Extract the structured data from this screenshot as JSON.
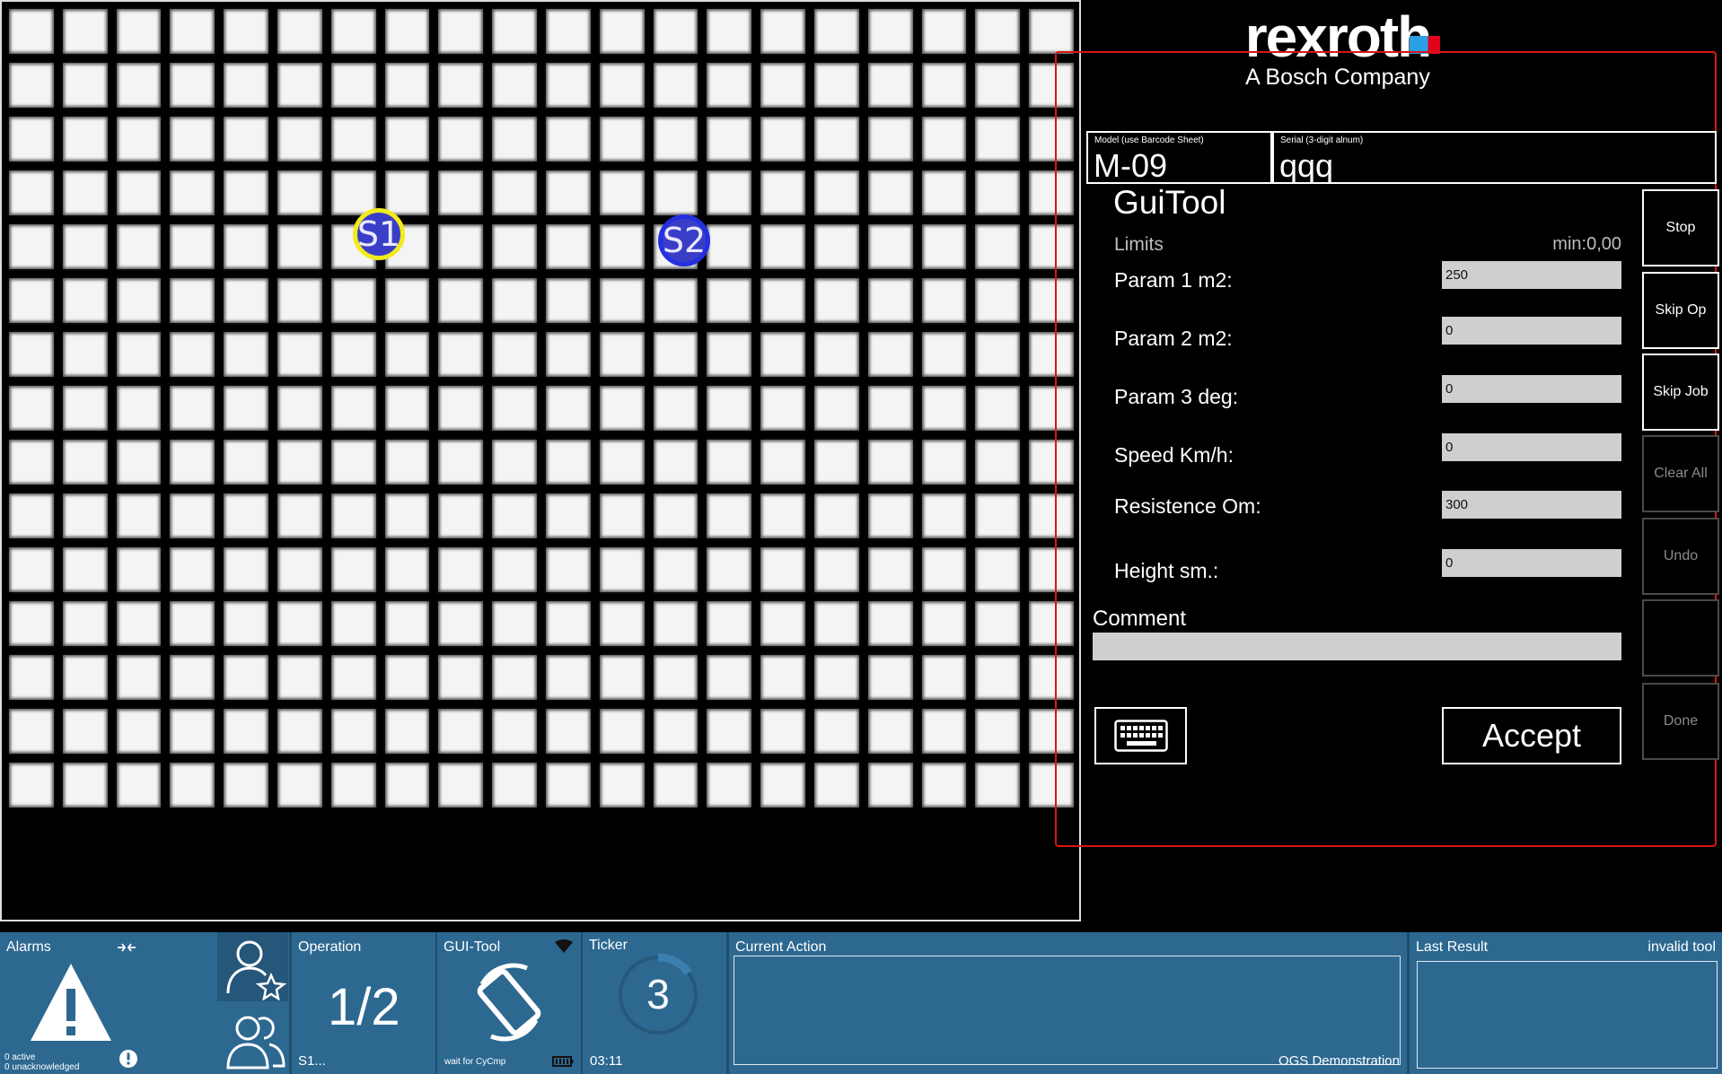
{
  "brand": {
    "name": "rexroth",
    "tagline": "A Bosch Company"
  },
  "grid": {
    "columns": 20,
    "rows": 15,
    "markers": [
      {
        "label": "S1",
        "state": "selected"
      },
      {
        "label": "S2",
        "state": "normal"
      }
    ]
  },
  "header_fields": {
    "model_label": "Model (use Barcode Sheet)",
    "model_value": "M-09",
    "serial_label": "Serial (3-digit alnum)",
    "serial_value": "qqq"
  },
  "tool": {
    "title": "GuiTool",
    "limits_label": "Limits",
    "limits_min": "min:0,00",
    "params": [
      {
        "label": "Param 1 m2:",
        "value": "250"
      },
      {
        "label": "Param 2 m2:",
        "value": "0"
      },
      {
        "label": "Param 3 deg:",
        "value": "0"
      },
      {
        "label": "Speed Km/h:",
        "value": "0"
      },
      {
        "label": "Resistence Om:",
        "value": "300"
      },
      {
        "label": "Height sm.:",
        "value": "0"
      }
    ],
    "comment_label": "Comment",
    "comment_value": "",
    "accept_label": "Accept",
    "keyboard_icon": "keyboard-icon"
  },
  "side_buttons": [
    {
      "label": "Stop",
      "enabled": true
    },
    {
      "label": "Skip Op",
      "enabled": true
    },
    {
      "label": "Skip Job",
      "enabled": true
    },
    {
      "label": "Clear All",
      "enabled": false
    },
    {
      "label": "Undo",
      "enabled": false
    },
    {
      "label": "",
      "enabled": false
    },
    {
      "label": "Done",
      "enabled": false
    }
  ],
  "status_bar": {
    "alarms": {
      "label": "Alarms",
      "active": "0 active",
      "unacknowledged": "0 unacknowledged"
    },
    "operation": {
      "label": "Operation",
      "value": "1/2",
      "sub": "S1..."
    },
    "gui_tool": {
      "label": "GUI-Tool",
      "status": "wait for CyCmp"
    },
    "ticker": {
      "label": "Ticker",
      "value": "3",
      "time": "03:11",
      "progress": 0.15
    },
    "current_action": {
      "label": "Current Action",
      "footer": "OGS Demonstration"
    },
    "last_result": {
      "label": "Last Result",
      "status": "invalid tool"
    }
  },
  "colors": {
    "accent": "#2d6890",
    "frame": "#d61616",
    "marker_selected": "#f2ea1c",
    "marker_fill": "#3a3ec7"
  }
}
